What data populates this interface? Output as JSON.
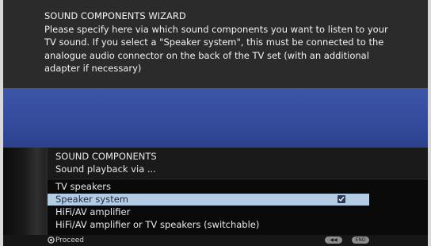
{
  "wizard": {
    "title": "SOUND COMPONENTS WIZARD",
    "lines": [
      "Please specify here via which sound components you want to listen to your",
      "TV sound. If you select a \"Speaker system\", this must be connected to the",
      "analogue audio connector on the back of the TV set (with an additional",
      "adapter if necessary)"
    ]
  },
  "menu": {
    "title": "SOUND COMPONENTS",
    "subtitle": "Sound playback via ...",
    "options": [
      {
        "label": "TV speakers",
        "selected": false,
        "checked": false
      },
      {
        "label": "Speaker system",
        "selected": true,
        "checked": true
      },
      {
        "label": "HiFi/AV amplifier",
        "selected": false,
        "checked": false
      },
      {
        "label": "HiFi/AV amplifier or TV speakers (switchable)",
        "selected": false,
        "checked": false
      }
    ]
  },
  "footer": {
    "proceed_label": "Proceed",
    "back_button": "◀◀",
    "end_button": "END"
  },
  "colors": {
    "info_panel": "#2b2b2b",
    "blue_band": "#3d55a8",
    "selected_row": "#b4cbe4"
  }
}
